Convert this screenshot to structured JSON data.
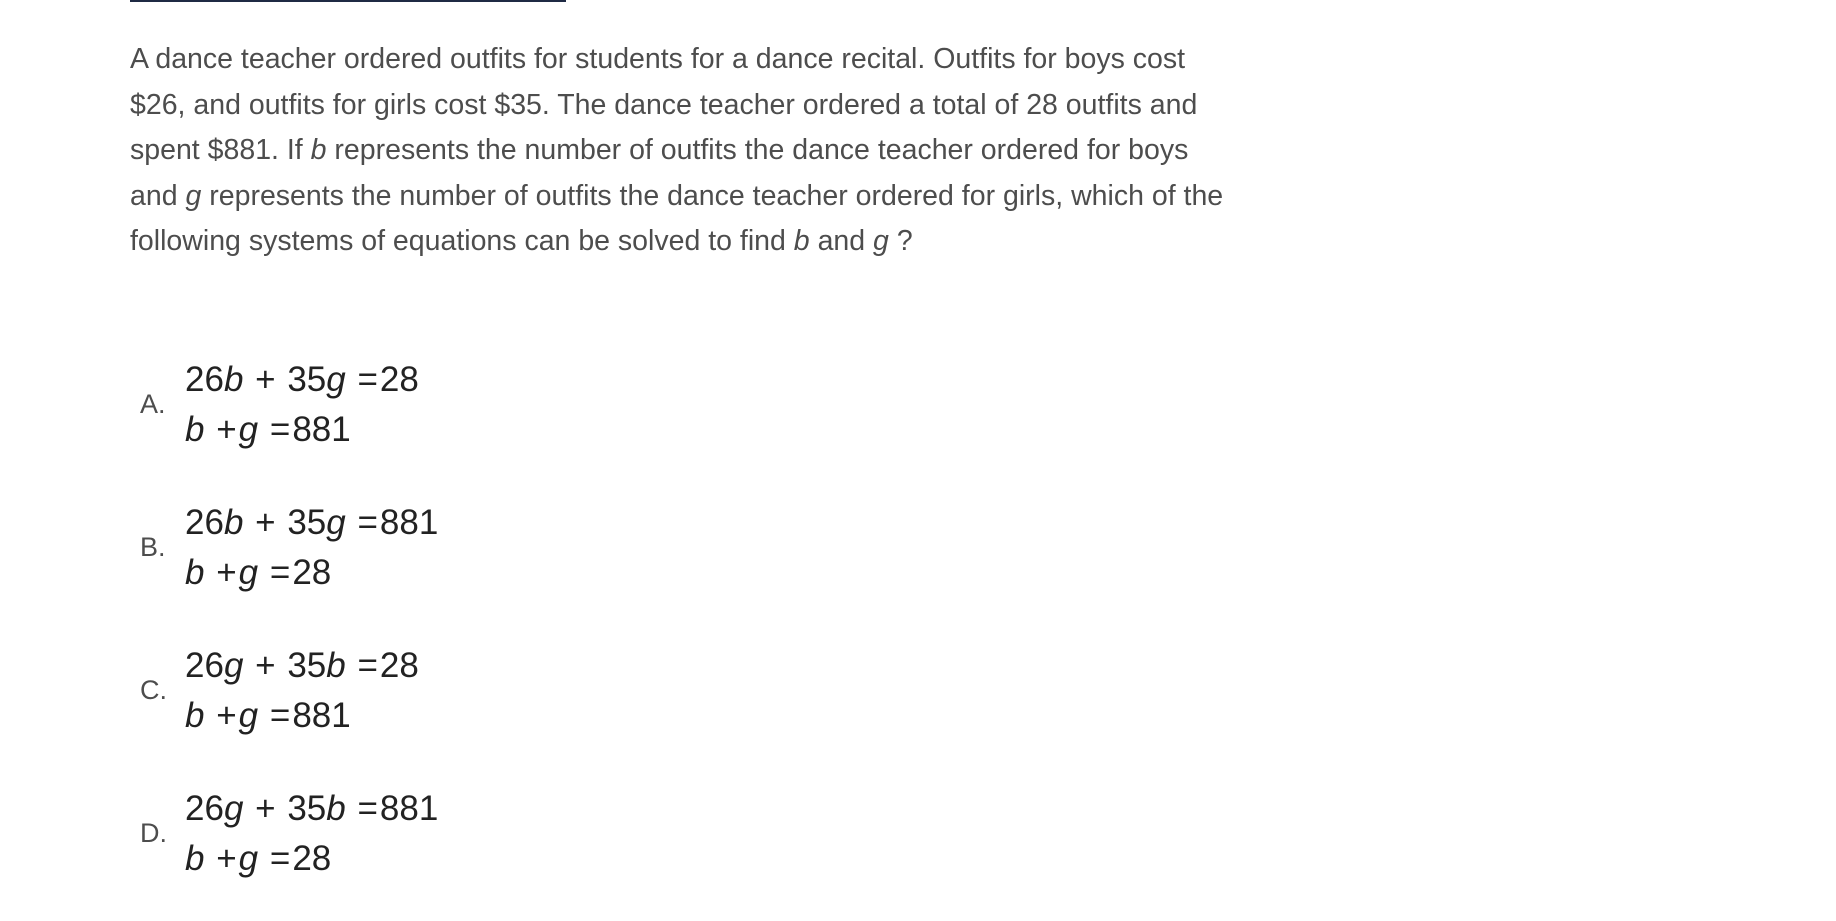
{
  "question": {
    "part1": "A dance teacher ordered outfits for students for a dance recital. Outfits for boys cost $26, and outfits for girls cost $35. The dance teacher ordered a total of 28 outfits and spent $881. If ",
    "var_b": "b",
    "part2": " represents the number of outfits the dance teacher ordered for boys and ",
    "var_g": "g",
    "part3": " represents the number of outfits the dance teacher ordered for girls, which of the following systems of equations can be solved to find ",
    "var_b2": "b",
    "part4": " and ",
    "var_g2": "g",
    "part5": " ?"
  },
  "choices": [
    {
      "letter": "A.",
      "line1": {
        "c1": "26",
        "v1": "b",
        "op": "+",
        "c2": "35",
        "v2": "g",
        "eq": "=",
        "rhs": "28"
      },
      "line2": {
        "v1": "b",
        "op": "+",
        "v2": "g",
        "eq": "=",
        "rhs": "881"
      }
    },
    {
      "letter": "B.",
      "line1": {
        "c1": "26",
        "v1": "b",
        "op": "+",
        "c2": "35",
        "v2": "g",
        "eq": "=",
        "rhs": "881"
      },
      "line2": {
        "v1": "b",
        "op": "+",
        "v2": "g",
        "eq": "=",
        "rhs": "28"
      }
    },
    {
      "letter": "C.",
      "line1": {
        "c1": "26",
        "v1": "g",
        "op": "+",
        "c2": "35",
        "v2": "b",
        "eq": "=",
        "rhs": "28"
      },
      "line2": {
        "v1": "b",
        "op": "+",
        "v2": "g",
        "eq": "=",
        "rhs": "881"
      }
    },
    {
      "letter": "D.",
      "line1": {
        "c1": "26",
        "v1": "g",
        "op": "+",
        "c2": "35",
        "v2": "b",
        "eq": "=",
        "rhs": "881"
      },
      "line2": {
        "v1": "b",
        "op": "+",
        "v2": "g",
        "eq": "=",
        "rhs": "28"
      }
    }
  ]
}
